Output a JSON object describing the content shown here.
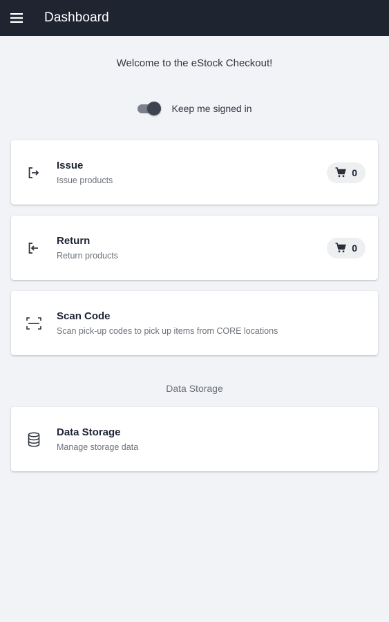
{
  "appbar": {
    "title": "Dashboard",
    "menu_icon": "menu-icon"
  },
  "welcome_text": "Welcome to the eStock Checkout!",
  "keep_signed_in": {
    "label": "Keep me signed in",
    "checked": true
  },
  "cards": {
    "issue": {
      "title": "Issue",
      "subtitle": "Issue products",
      "icon": "logout-icon",
      "cart_count": "0"
    },
    "return": {
      "title": "Return",
      "subtitle": "Return products",
      "icon": "login-icon",
      "cart_count": "0"
    },
    "scan": {
      "title": "Scan Code",
      "subtitle": "Scan pick-up codes to pick up items from CORE locations",
      "icon": "scan-icon"
    }
  },
  "data_storage_section": {
    "heading": "Data Storage",
    "card": {
      "title": "Data Storage",
      "subtitle": "Manage storage data",
      "icon": "database-icon"
    }
  },
  "colors": {
    "appbar": "#1e2430",
    "background": "#f1f3f7",
    "card": "#ffffff"
  }
}
